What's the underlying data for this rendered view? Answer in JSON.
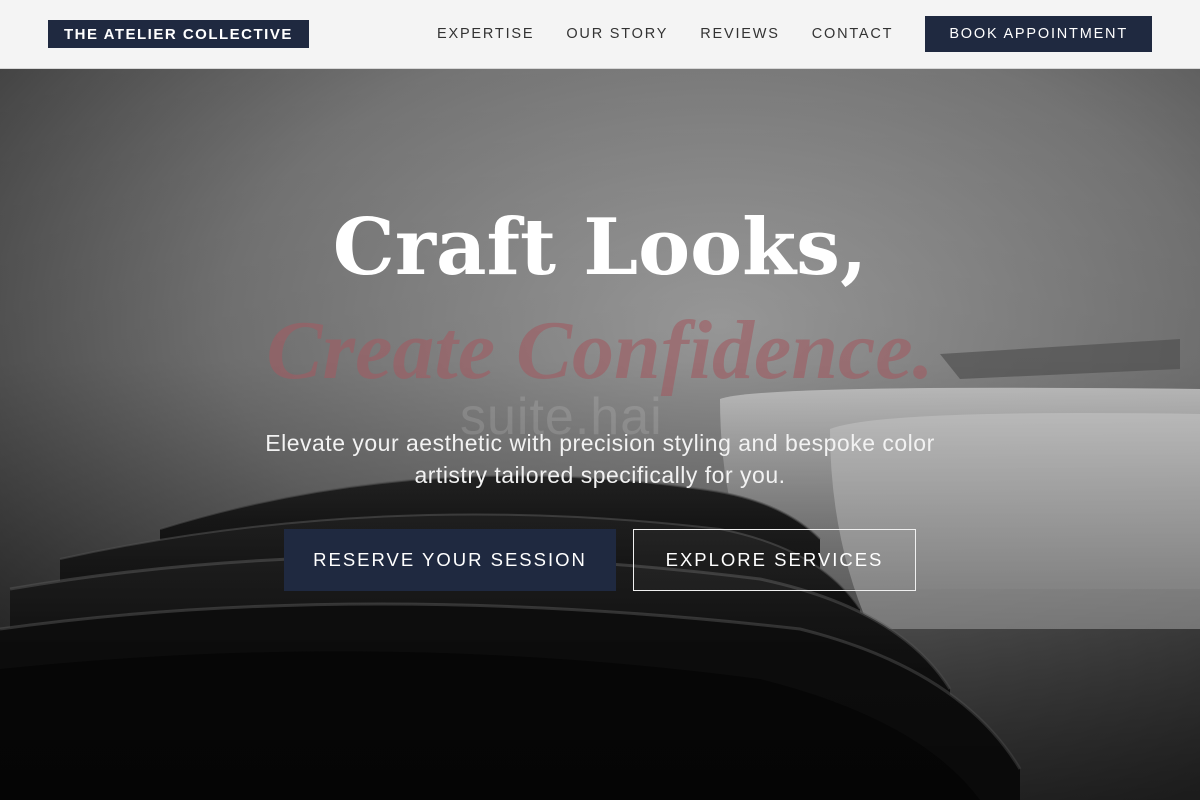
{
  "brand": {
    "name": "THE ATELIER COLLECTIVE"
  },
  "nav": {
    "items": [
      "EXPERTISE",
      "OUR STORY",
      "REVIEWS",
      "CONTACT"
    ],
    "cta": "BOOK APPOINTMENT"
  },
  "hero": {
    "headline_line1": "Craft Looks,",
    "headline_line2": "Create Confidence.",
    "watermark": "suite.hai",
    "subtitle": "Elevate your aesthetic with precision styling and bespoke color artistry tailored specifically for you.",
    "primary_cta": "RESERVE YOUR SESSION",
    "secondary_cta": "EXPLORE SERVICES"
  },
  "colors": {
    "brand_navy": "#1f2940",
    "accent_rose": "#a05c62",
    "header_bg": "#f4f4f4"
  }
}
